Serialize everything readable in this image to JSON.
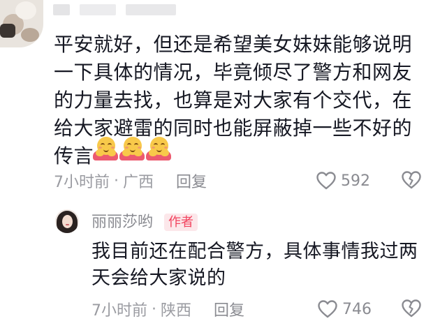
{
  "comment": {
    "text": "平安就好，但还是希望美女妹妹能够说明一下具体的情况，毕竟倾尽了警方和网友的力量去找，也算是对大家有个交代，在给大家避雷的同时也能屏蔽掉一些不好的传言",
    "emoji": "hugging-face-emoji",
    "emoji_count": 3,
    "time": "7小时前",
    "separator": "·",
    "location": "广西",
    "reply_label": "回复",
    "like_count": "592"
  },
  "reply": {
    "author_name": "丽丽莎哟",
    "author_badge": "作者",
    "text": "我目前还在配合警方，具体事情我过两天会给大家说的",
    "time": "7小时前",
    "separator": "·",
    "location": "陕西",
    "reply_label": "回复",
    "like_count": "746"
  },
  "icons": {
    "like": "heart-outline-icon",
    "dislike": "broken-heart-icon"
  },
  "colors": {
    "text": "#161823",
    "meta": "#9a9ba1",
    "badge_bg": "#fce7ea",
    "badge_text": "#f2435e"
  }
}
